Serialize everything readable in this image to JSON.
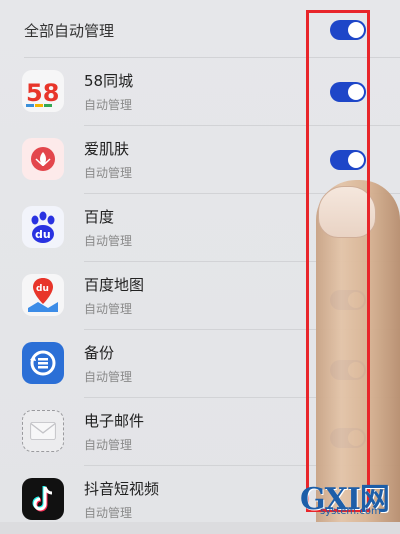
{
  "master": {
    "label": "全部自动管理",
    "toggle_on": true
  },
  "apps": [
    {
      "name": "58同城",
      "status": "自动管理",
      "icon": "58-tongcheng-icon",
      "toggle_on": true
    },
    {
      "name": "爱肌肤",
      "status": "自动管理",
      "icon": "aijifu-icon",
      "toggle_on": true
    },
    {
      "name": "百度",
      "status": "自动管理",
      "icon": "baidu-icon",
      "toggle_on": true
    },
    {
      "name": "百度地图",
      "status": "自动管理",
      "icon": "baidu-map-icon",
      "toggle_on": true
    },
    {
      "name": "备份",
      "status": "自动管理",
      "icon": "backup-icon",
      "toggle_on": true
    },
    {
      "name": "电子邮件",
      "status": "自动管理",
      "icon": "email-icon",
      "toggle_on": true
    },
    {
      "name": "抖音短视频",
      "status": "自动管理",
      "icon": "douyin-icon",
      "toggle_on": true
    }
  ],
  "icon_text": {
    "logo_58": "58",
    "baidu_du": "du",
    "map_du": "du"
  },
  "watermark": {
    "main": "GXI网",
    "sub": "system.com"
  },
  "colors": {
    "toggle_on": "#1e46c8",
    "highlight": "#e8252a",
    "background": "#e5e6e9"
  }
}
